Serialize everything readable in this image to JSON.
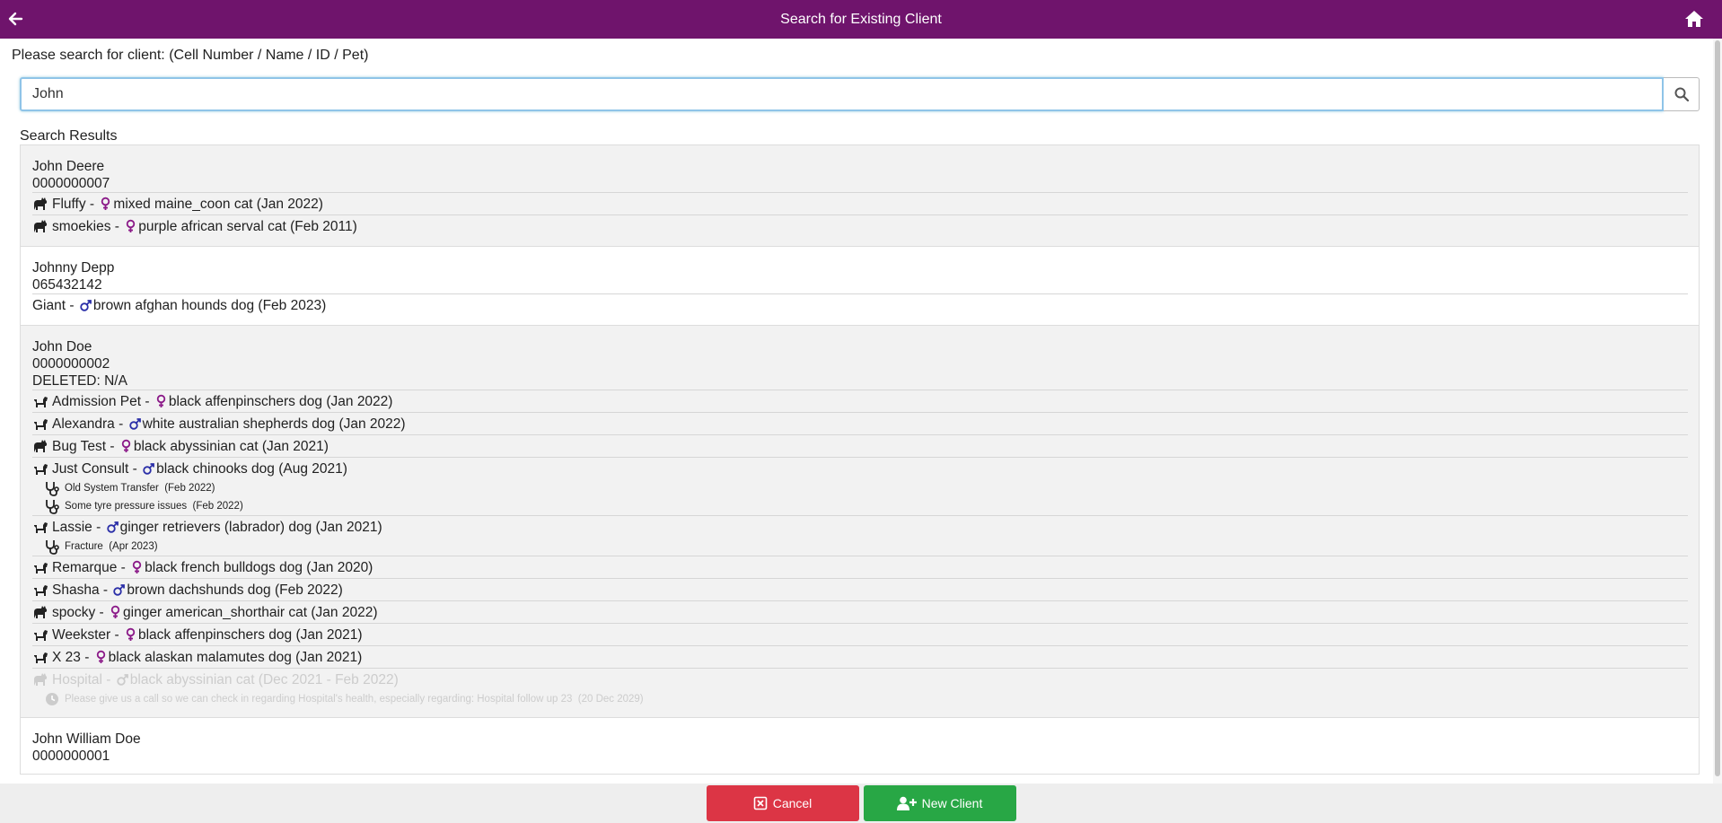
{
  "header": {
    "title": "Search for Existing Client"
  },
  "search": {
    "prompt": "Please search for client: (Cell Number / Name / ID / Pet)",
    "value": "John",
    "results_label": "Search Results"
  },
  "clients": [
    {
      "name": "John Deere",
      "phone": "0000000007",
      "bg": "grey",
      "pets": [
        {
          "species": "cat",
          "sex": "female",
          "name": "Fluffy",
          "desc": "mixed maine_coon cat (Jan 2022)"
        },
        {
          "species": "cat",
          "sex": "female",
          "name": "smoekies",
          "desc": "purple african serval cat (Feb 2011)"
        }
      ]
    },
    {
      "name": "Johnny Depp",
      "phone": "065432142",
      "bg": "white",
      "pets": [
        {
          "species": "none",
          "sex": "male",
          "name": "Giant",
          "desc": "brown afghan hounds dog (Feb 2023)"
        }
      ]
    },
    {
      "name": "John Doe",
      "phone": "0000000002",
      "deleted": "DELETED: N/A",
      "bg": "grey",
      "pets": [
        {
          "species": "dog",
          "sex": "female",
          "name": "Admission Pet",
          "desc": "black affenpinschers dog (Jan 2022)"
        },
        {
          "species": "dog",
          "sex": "male",
          "name": "Alexandra",
          "desc": "white australian shepherds dog (Jan 2022)"
        },
        {
          "species": "cat",
          "sex": "female",
          "name": "Bug Test",
          "desc": "black abyssinian cat (Jan 2021)"
        },
        {
          "species": "dog",
          "sex": "male",
          "name": "Just Consult",
          "desc": "black chinooks dog (Aug 2021)",
          "consults": [
            {
              "text": "Old System Transfer",
              "date": "(Feb 2022)"
            },
            {
              "text": "Some tyre pressure issues",
              "date": "(Feb 2022)"
            }
          ]
        },
        {
          "species": "dog",
          "sex": "male",
          "name": "Lassie",
          "desc": "ginger retrievers (labrador) dog (Jan 2021)",
          "consults": [
            {
              "text": "Fracture",
              "date": "(Apr 2023)"
            }
          ]
        },
        {
          "species": "dog",
          "sex": "female",
          "name": "Remarque",
          "desc": "black french bulldogs dog (Jan 2020)"
        },
        {
          "species": "dog",
          "sex": "male",
          "name": "Shasha",
          "desc": "brown dachshunds dog (Feb 2022)"
        },
        {
          "species": "cat",
          "sex": "female",
          "name": "spocky",
          "desc": "ginger american_shorthair cat (Jan 2022)"
        },
        {
          "species": "dog",
          "sex": "female",
          "name": "Weekster",
          "desc": "black affenpinschers dog (Jan 2021)"
        },
        {
          "species": "dog",
          "sex": "female",
          "name": "X 23",
          "desc": "black alaskan malamutes dog (Jan 2021)"
        },
        {
          "species": "cat",
          "sex": "male",
          "name": "Hospital",
          "desc": "black abyssinian cat (Dec 2021 - Feb 2022)",
          "faded": true,
          "consults": [
            {
              "icon": "clock",
              "text": "Please give us a call so we can check in regarding Hospital's health, especially regarding: Hospital follow up 23",
              "date": "(20 Dec 2029)"
            }
          ]
        }
      ]
    },
    {
      "name": "John William Doe",
      "phone": "0000000001",
      "bg": "white",
      "pets": []
    }
  ],
  "footer": {
    "cancel_label": "Cancel",
    "new_client_label": "New Client"
  },
  "colors": {
    "header_bg": "#6f146c",
    "female": "#8b1a88",
    "male": "#2b2fa8",
    "cancel": "#dc3545",
    "new_client": "#28a745"
  }
}
